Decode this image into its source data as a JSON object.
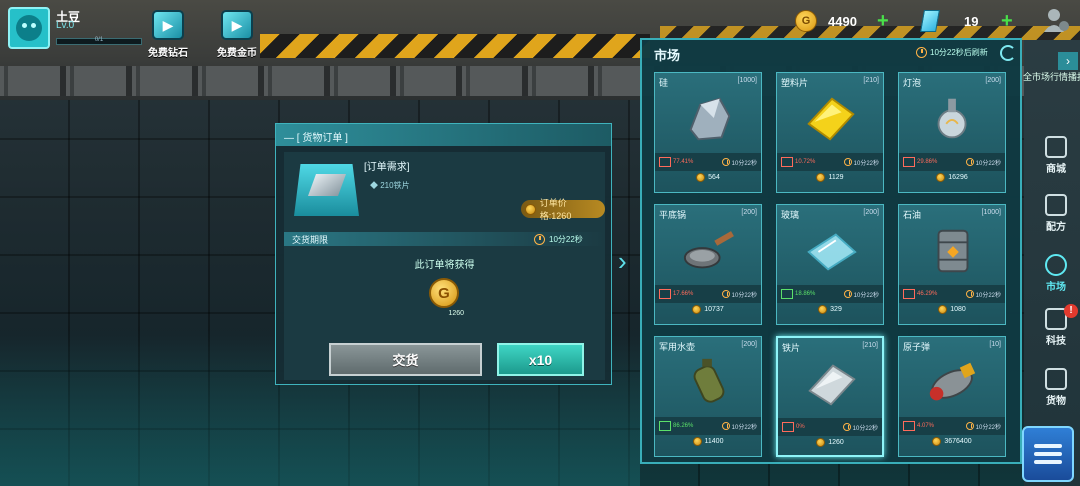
{
  "player": {
    "name": "土豆",
    "level": "Lv.0",
    "xp": "0/1"
  },
  "free_buttons": [
    {
      "label": "免费钻石",
      "icon": "video-play-icon"
    },
    {
      "label": "免费金币",
      "icon": "video-coin-icon"
    }
  ],
  "currency": {
    "coins": "4490",
    "gems": "19"
  },
  "order": {
    "header": "— [ 货物订单 ]",
    "requirement_title": "[订单需求]",
    "requirement_item": "◆ 210铁片",
    "price": "订单价格:1260",
    "deadline_label": "交货期限",
    "deadline_time": "10分22秒",
    "reward_label": "此订单将获得",
    "reward_coin": "G",
    "reward_value": "1260",
    "deliver_label": "交货",
    "multiplier_label": "x10"
  },
  "market": {
    "title": "市场",
    "refresh_text": "10分22秒后刷新",
    "items": [
      {
        "name": "硅",
        "qty": "[1000]",
        "trend": "up",
        "change": "77.41%",
        "time": "10分22秒",
        "price": "564",
        "art": "rock"
      },
      {
        "name": "塑料片",
        "qty": "[210]",
        "trend": "up",
        "change": "10.72%",
        "time": "10分22秒",
        "price": "1129",
        "art": "plastic"
      },
      {
        "name": "灯泡",
        "qty": "[200]",
        "trend": "up",
        "change": "29.86%",
        "time": "10分22秒",
        "price": "16296",
        "art": "bulb"
      },
      {
        "name": "平底锅",
        "qty": "[200]",
        "trend": "up",
        "change": "17.66%",
        "time": "10分22秒",
        "price": "10737",
        "art": "pan"
      },
      {
        "name": "玻璃",
        "qty": "[200]",
        "trend": "down",
        "change": "18.86%",
        "time": "10分22秒",
        "price": "329",
        "art": "glass"
      },
      {
        "name": "石油",
        "qty": "[1000]",
        "trend": "up",
        "change": "46.29%",
        "time": "10分22秒",
        "price": "1080",
        "art": "barrel"
      },
      {
        "name": "军用水壶",
        "qty": "[200]",
        "trend": "down",
        "change": "86.26%",
        "time": "10分22秒",
        "price": "11400",
        "art": "canteen"
      },
      {
        "name": "铁片",
        "qty": "[210]",
        "trend": "up",
        "change": "0%",
        "time": "10分22秒",
        "price": "1260",
        "art": "plate"
      },
      {
        "name": "原子弹",
        "qty": "[10]",
        "trend": "up",
        "change": "4.07%",
        "time": "10分22秒",
        "price": "3676400",
        "art": "bomb"
      }
    ]
  },
  "sidebar": {
    "ticker": "全市场行情播报",
    "items": [
      {
        "label": "商城",
        "icon": "shop-cart-icon"
      },
      {
        "label": "配方",
        "icon": "recipe-icon"
      },
      {
        "label": "市场",
        "icon": "market-icon"
      },
      {
        "label": "科技",
        "icon": "tech-icon"
      },
      {
        "label": "货物",
        "icon": "cargo-icon"
      }
    ]
  },
  "colors": {
    "accent": "#39aeb9",
    "coin": "#d99712",
    "up": "#ff6b5b",
    "down": "#5be06a",
    "plus": "#49e04a"
  }
}
